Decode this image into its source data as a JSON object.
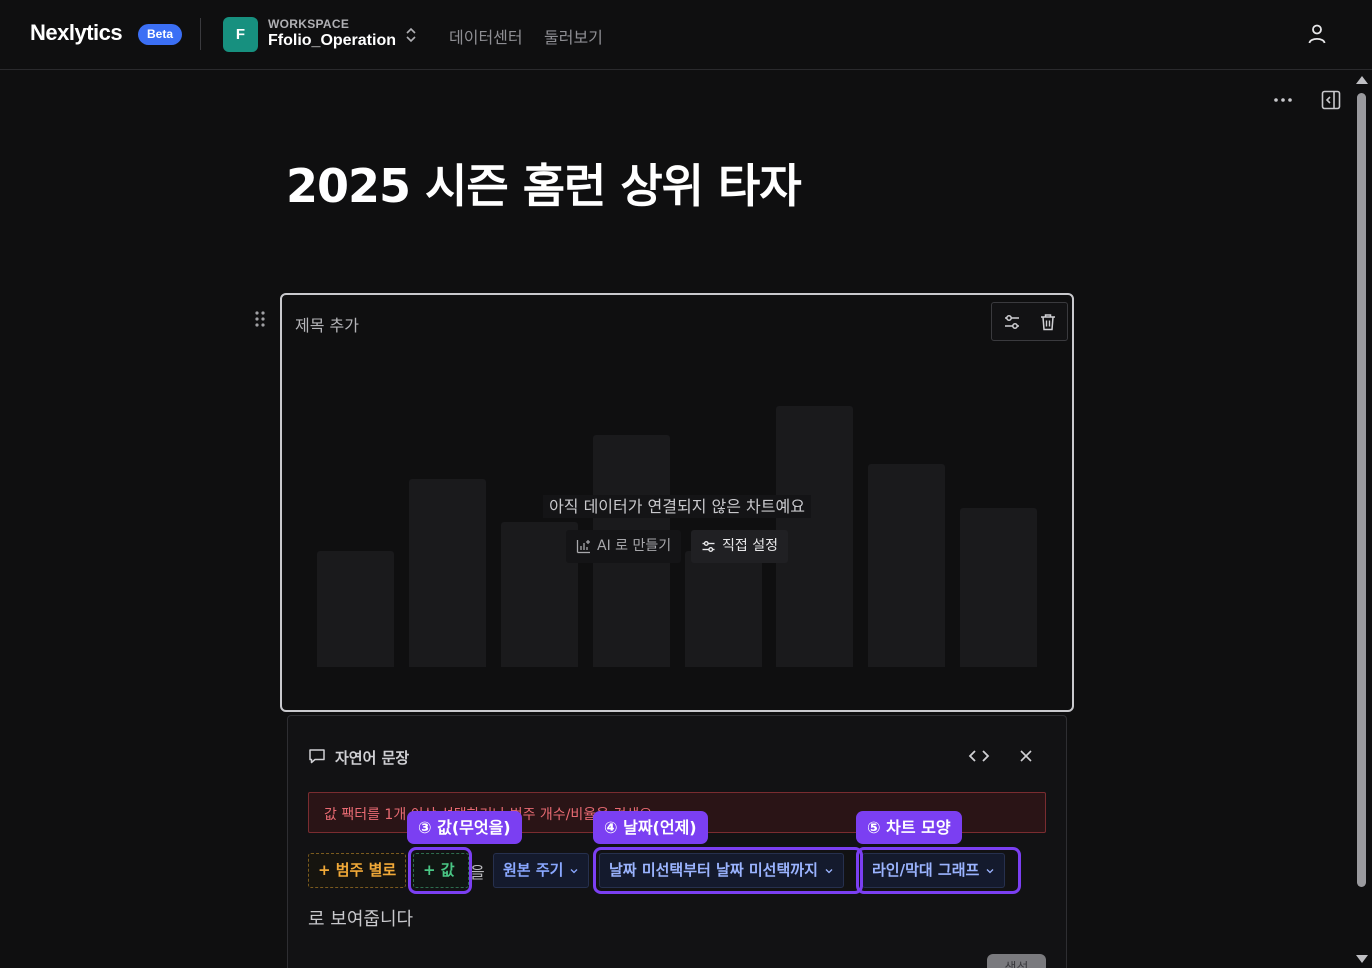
{
  "header": {
    "logo": "Nexlytics",
    "beta_badge": "Beta",
    "workspace_initial": "F",
    "workspace_caption": "WORKSPACE",
    "workspace_name": "Ffolio_Operation",
    "nav": [
      "데이터센터",
      "둘러보기"
    ]
  },
  "page": {
    "title": "2025 시즌 홈런 상위 타자"
  },
  "chart_card": {
    "title_placeholder": "제목 추가",
    "empty_message": "아직 데이터가 연결되지 않은 차트예요",
    "ai_button": "AI 로 만들기",
    "manual_button": "직접 설정"
  },
  "nl_panel": {
    "header": "자연어 문장",
    "error": "값 팩터를 1개 이상 선택하거나 범주 개수/비율을 검색요",
    "chip_category": "+ 범주 별로",
    "chip_value": "+ 값",
    "word_eul": "을",
    "chip_period": "원본 주기",
    "chip_date": "날짜 미선택부터 날짜 미선택까지",
    "chip_type": "라인/막대 그래프",
    "suffix": "로 보여줍니다",
    "apply_button": "생성"
  },
  "annotations": {
    "tag_3": "③ 값(무엇을)",
    "tag_4": "④ 날짜(언제)",
    "tag_5": "⑤ 차트 모양"
  },
  "colors": {
    "accent_purple": "#7b3ff2",
    "beta_blue": "#3b6ff5",
    "workspace_teal": "#17907f",
    "category_orange": "#f1a938",
    "value_green": "#49c785",
    "token_blue": "#9bb4ff",
    "error_red": "#e76a72"
  },
  "icons": [
    "workspace-switch-icon",
    "user-icon",
    "more-icon",
    "panel-toggle-icon",
    "drag-handle-icon",
    "settings-sliders-icon",
    "trash-icon",
    "chart-ai-icon",
    "chat-bubble-icon",
    "code-icon",
    "close-icon",
    "chevron-down-icon"
  ]
}
